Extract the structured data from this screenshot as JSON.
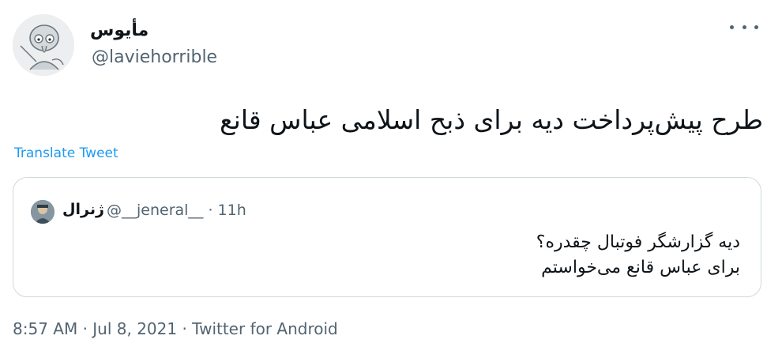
{
  "author": {
    "display_name": "مأیوس",
    "handle": "@laviehorrible"
  },
  "tweet": {
    "text": "طرح پیش‌پرداخت دیه برای ذبح اسلامی عباس قانع",
    "translate_label": "Translate Tweet",
    "meta": "8:57 AM · Jul 8, 2021 · Twitter for Android"
  },
  "quote": {
    "display_name": "ژنرال",
    "handle_time": "@__jeneral__ · 11h",
    "lines": [
      "دیه گزارشگر فوتبال چقدره؟",
      "برای عباس قانع می‌خواستم"
    ]
  },
  "colors": {
    "link": "#1d9bf0",
    "secondary_text": "#536471",
    "border": "#cfd9de"
  },
  "icons": {
    "more": "more-horizontal-icon"
  }
}
